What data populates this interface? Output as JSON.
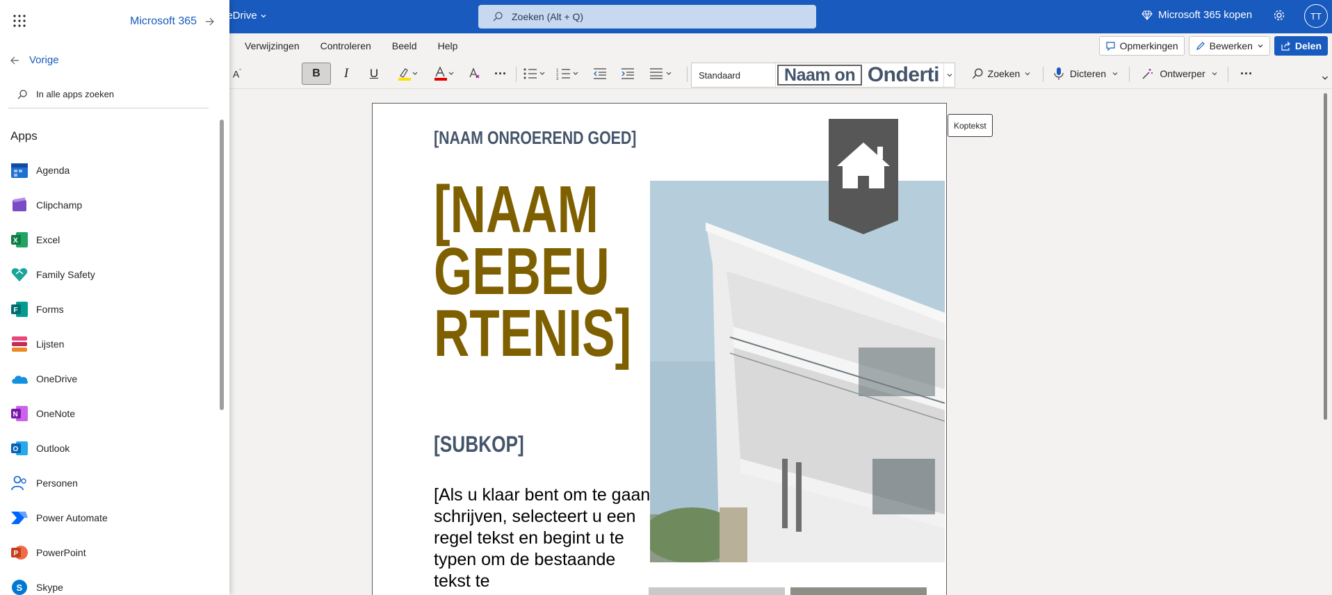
{
  "topbar": {
    "product": "neDrive",
    "search_placeholder": "Zoeken (Alt + Q)",
    "buy_label": "Microsoft 365 kopen",
    "avatar_initials": "TT",
    "color": "#185abd"
  },
  "menu": {
    "tabs": [
      "Verwijzingen",
      "Controleren",
      "Beeld",
      "Help"
    ],
    "comments_label": "Opmerkingen",
    "edit_label": "Bewerken",
    "share_label": "Delen"
  },
  "ribbon": {
    "bold": "B",
    "italic": "I",
    "underline": "U",
    "more": "···",
    "style_standard": "Standaard",
    "style_preview_1": "Naam on",
    "style_preview_2": "Onderti",
    "search_label": "Zoeken",
    "dictate_label": "Dicteren",
    "designer_label": "Ontwerper"
  },
  "document": {
    "property_name": "[NAAM ONROEREND GOED]",
    "event_name": "[NAAM\nGEBEU\nRTENIS]",
    "subheading": "[SUBKOP]",
    "body_text": "[Als u klaar bent om te gaan schrijven, selecteert u een regel tekst en begint u te typen om de bestaande tekst te",
    "header_tooltip": "Koptekst",
    "title_color": "#7f6000",
    "heading_color": "#44546a"
  },
  "launcher": {
    "title": "Microsoft 365",
    "back_label": "Vorige",
    "search_placeholder": "In alle apps zoeken",
    "apps_heading": "Apps",
    "apps": [
      {
        "name": "Agenda",
        "icon": "calendar-icon"
      },
      {
        "name": "Clipchamp",
        "icon": "clipchamp-icon"
      },
      {
        "name": "Excel",
        "icon": "excel-icon"
      },
      {
        "name": "Family Safety",
        "icon": "family-safety-icon"
      },
      {
        "name": "Forms",
        "icon": "forms-icon"
      },
      {
        "name": "Lijsten",
        "icon": "lists-icon"
      },
      {
        "name": "OneDrive",
        "icon": "onedrive-icon"
      },
      {
        "name": "OneNote",
        "icon": "onenote-icon"
      },
      {
        "name": "Outlook",
        "icon": "outlook-icon"
      },
      {
        "name": "Personen",
        "icon": "people-icon"
      },
      {
        "name": "Power Automate",
        "icon": "power-automate-icon"
      },
      {
        "name": "PowerPoint",
        "icon": "powerpoint-icon"
      },
      {
        "name": "Skype",
        "icon": "skype-icon"
      }
    ]
  }
}
